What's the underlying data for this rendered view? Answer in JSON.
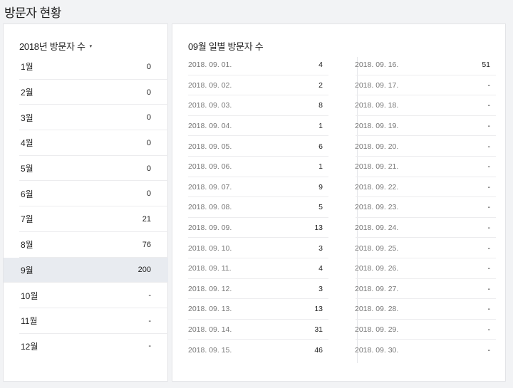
{
  "page_title": "방문자 현황",
  "year_selector": {
    "label": "2018년 방문자 수",
    "caret": "▾"
  },
  "months": [
    {
      "label": "1월",
      "value": "0"
    },
    {
      "label": "2월",
      "value": "0"
    },
    {
      "label": "3월",
      "value": "0"
    },
    {
      "label": "4월",
      "value": "0"
    },
    {
      "label": "5월",
      "value": "0"
    },
    {
      "label": "6월",
      "value": "0"
    },
    {
      "label": "7월",
      "value": "21"
    },
    {
      "label": "8월",
      "value": "76"
    },
    {
      "label": "9월",
      "value": "200"
    },
    {
      "label": "10월",
      "value": "-"
    },
    {
      "label": "11월",
      "value": "-"
    },
    {
      "label": "12월",
      "value": "-"
    }
  ],
  "selected_month_index": 8,
  "daily_title": "09월 일별 방문자 수",
  "daily_left": [
    {
      "date": "2018. 09. 01.",
      "value": "4"
    },
    {
      "date": "2018. 09. 02.",
      "value": "2"
    },
    {
      "date": "2018. 09. 03.",
      "value": "8"
    },
    {
      "date": "2018. 09. 04.",
      "value": "1"
    },
    {
      "date": "2018. 09. 05.",
      "value": "6"
    },
    {
      "date": "2018. 09. 06.",
      "value": "1"
    },
    {
      "date": "2018. 09. 07.",
      "value": "9"
    },
    {
      "date": "2018. 09. 08.",
      "value": "5"
    },
    {
      "date": "2018. 09. 09.",
      "value": "13"
    },
    {
      "date": "2018. 09. 10.",
      "value": "3"
    },
    {
      "date": "2018. 09. 11.",
      "value": "4"
    },
    {
      "date": "2018. 09. 12.",
      "value": "3"
    },
    {
      "date": "2018. 09. 13.",
      "value": "13"
    },
    {
      "date": "2018. 09. 14.",
      "value": "31"
    },
    {
      "date": "2018. 09. 15.",
      "value": "46"
    }
  ],
  "daily_right": [
    {
      "date": "2018. 09. 16.",
      "value": "51"
    },
    {
      "date": "2018. 09. 17.",
      "value": "-"
    },
    {
      "date": "2018. 09. 18.",
      "value": "-"
    },
    {
      "date": "2018. 09. 19.",
      "value": "-"
    },
    {
      "date": "2018. 09. 20.",
      "value": "-"
    },
    {
      "date": "2018. 09. 21.",
      "value": "-"
    },
    {
      "date": "2018. 09. 22.",
      "value": "-"
    },
    {
      "date": "2018. 09. 23.",
      "value": "-"
    },
    {
      "date": "2018. 09. 24.",
      "value": "-"
    },
    {
      "date": "2018. 09. 25.",
      "value": "-"
    },
    {
      "date": "2018. 09. 26.",
      "value": "-"
    },
    {
      "date": "2018. 09. 27.",
      "value": "-"
    },
    {
      "date": "2018. 09. 28.",
      "value": "-"
    },
    {
      "date": "2018. 09. 29.",
      "value": "-"
    },
    {
      "date": "2018. 09. 30.",
      "value": "-"
    }
  ]
}
